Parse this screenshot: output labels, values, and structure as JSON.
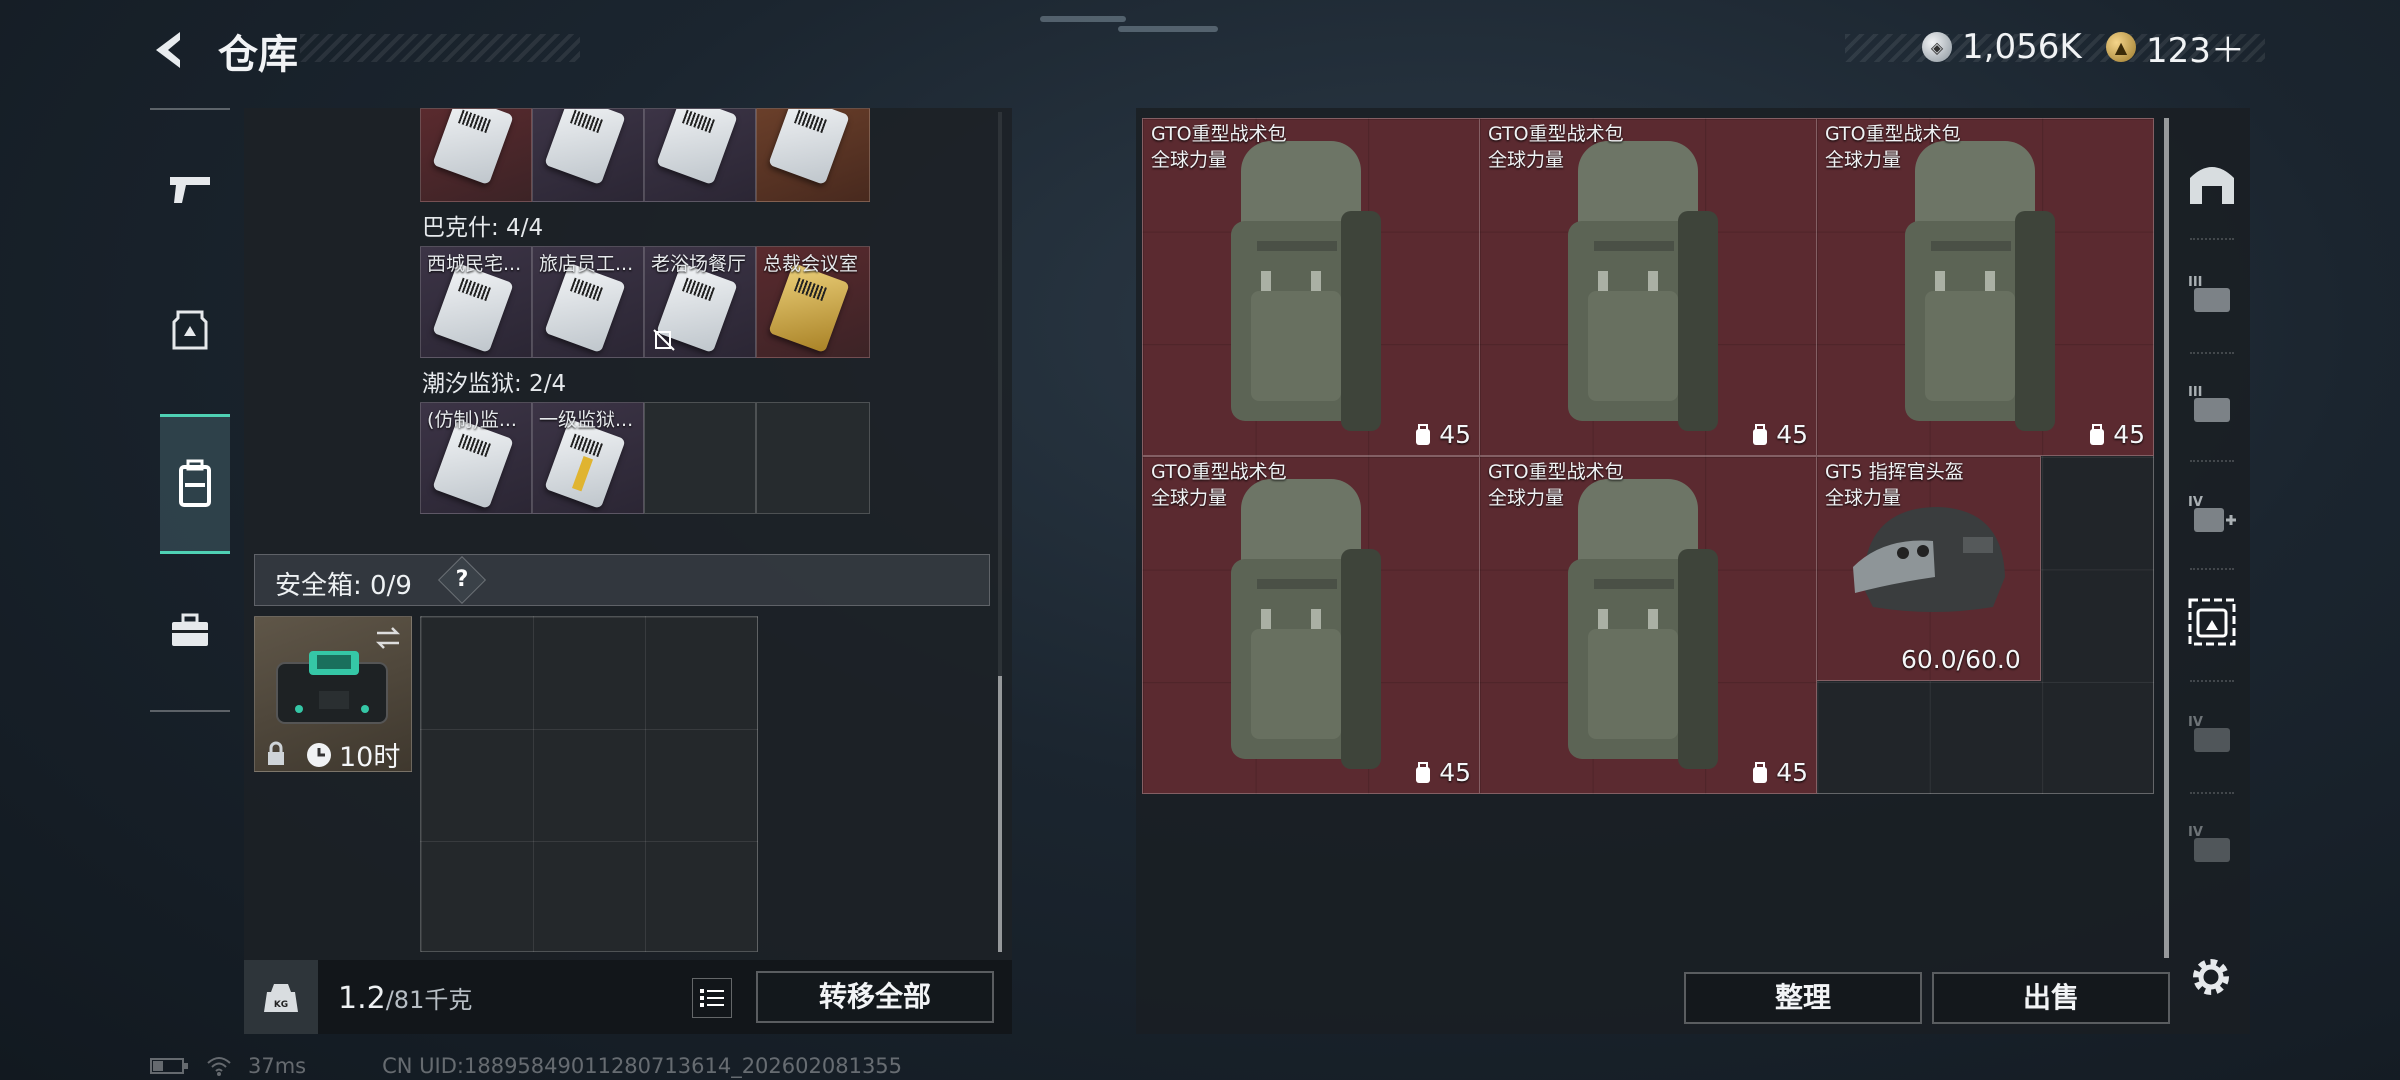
{
  "header": {
    "title": "仓库",
    "currencies": [
      {
        "icon": "silver-coin-icon",
        "value": "1,056K"
      },
      {
        "icon": "gold-coin-icon",
        "value": "123＋"
      }
    ]
  },
  "left_nav": {
    "items": [
      {
        "name": "weapon-tab",
        "icon": "pistol-icon"
      },
      {
        "name": "gear-tab",
        "icon": "armor-icon"
      },
      {
        "name": "backpack-tab",
        "icon": "backpack-icon",
        "active": true
      },
      {
        "name": "case-tab",
        "icon": "briefcase-icon"
      }
    ]
  },
  "keycards": {
    "group1": {
      "label": "巴克什: 4/4",
      "cards": [
        "西城民宅...",
        "旅店员工...",
        "老浴场餐厅",
        "总裁会议室"
      ]
    },
    "group2": {
      "label": "潮汐监狱: 2/4",
      "cards": [
        "(仿制)监...",
        "一级监狱..."
      ]
    }
  },
  "safebox": {
    "label": "安全箱: 0/9",
    "help": "?",
    "timer": "10时"
  },
  "footer": {
    "weight_current": "1.2",
    "weight_max": "/81千克",
    "kg_label": "KG",
    "transfer_all": "转移全部",
    "sort": "整理",
    "sell": "出售"
  },
  "stash": {
    "items": [
      {
        "name": "GTO重型战术包",
        "faction": "全球力量",
        "capacity": "45"
      },
      {
        "name": "GTO重型战术包",
        "faction": "全球力量",
        "capacity": "45"
      },
      {
        "name": "GTO重型战术包",
        "faction": "全球力量",
        "capacity": "45"
      },
      {
        "name": "GTO重型战术包",
        "faction": "全球力量",
        "capacity": "45"
      },
      {
        "name": "GTO重型战术包",
        "faction": "全球力量",
        "capacity": "45"
      },
      {
        "name": "GT5 指挥官头盔",
        "faction": "全球力量",
        "durability": "60.0/60.0"
      }
    ]
  },
  "side_tabs": [
    "stash-home-icon",
    "tier3-armor-icon",
    "tier3-rig-icon",
    "tier4-medical-icon",
    "tier-helmet-icon",
    "tier4-weapon-icon",
    "tier4-case-icon"
  ],
  "status": {
    "ping": "37ms",
    "uid": "CN UID:1889584901128071361​4_202602081355"
  }
}
